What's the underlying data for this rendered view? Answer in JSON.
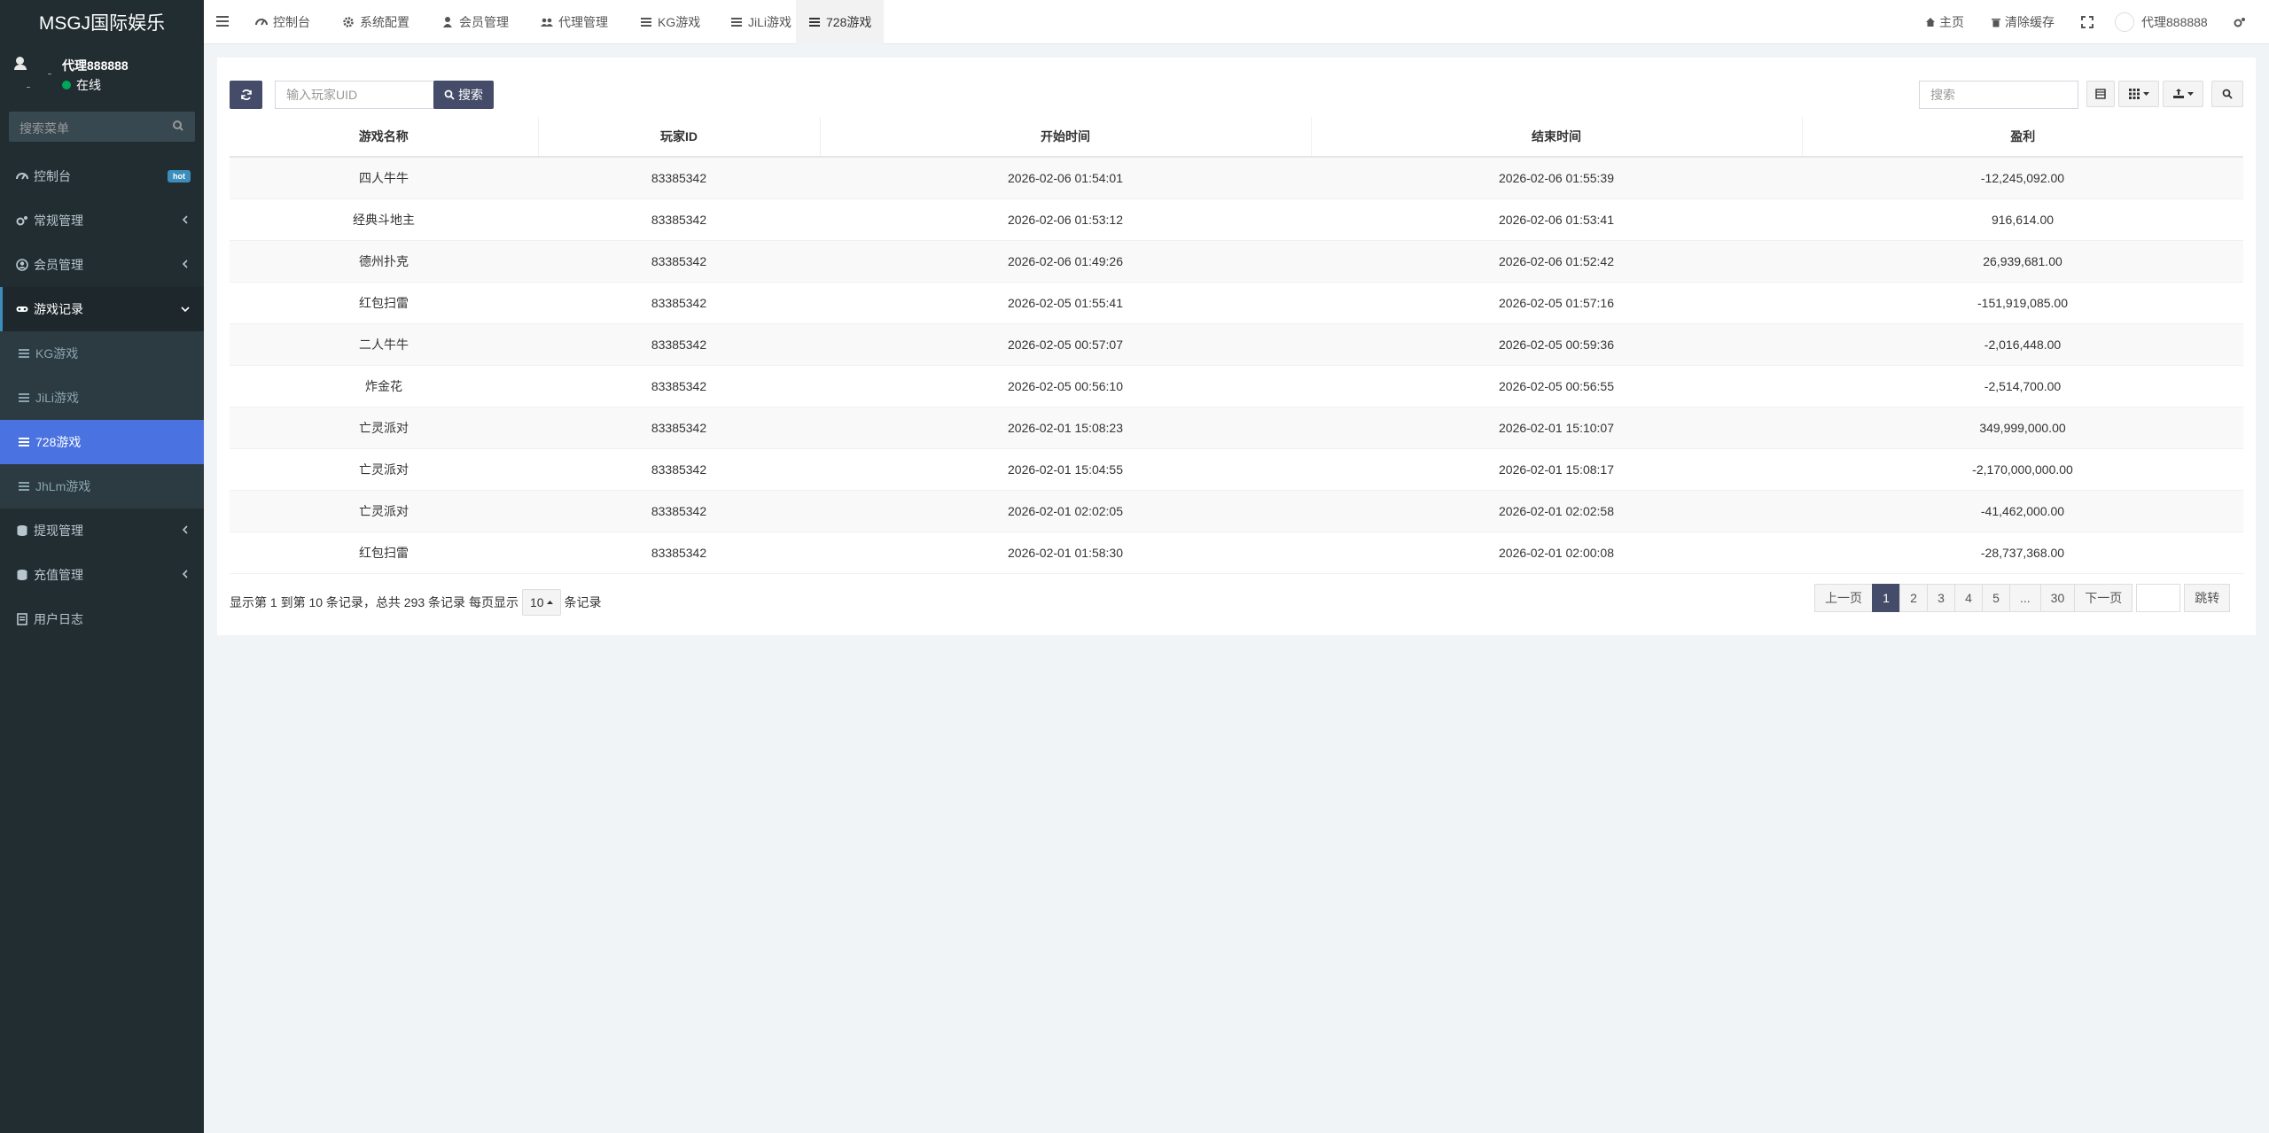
{
  "app": {
    "logo": "MSGJ国际娱乐"
  },
  "user": {
    "name": "代理888888",
    "status": "在线"
  },
  "sidebar": {
    "search_placeholder": "搜索菜单",
    "items": [
      {
        "label": "控制台",
        "badge": "hot",
        "icon": "dashboard-icon"
      },
      {
        "label": "常规管理",
        "icon": "cogs-icon"
      },
      {
        "label": "会员管理",
        "icon": "user-circle-icon"
      },
      {
        "label": "游戏记录",
        "icon": "gamepad-icon"
      },
      {
        "label": "提现管理",
        "icon": "database-icon"
      },
      {
        "label": "充值管理",
        "icon": "database-icon"
      },
      {
        "label": "用户日志",
        "icon": "list-icon"
      }
    ],
    "sub_items": [
      {
        "label": "KG游戏"
      },
      {
        "label": "JiLi游戏"
      },
      {
        "label": "728游戏"
      },
      {
        "label": "JhLm游戏"
      }
    ]
  },
  "tabs": [
    {
      "label": "控制台"
    },
    {
      "label": "系统配置"
    },
    {
      "label": "会员管理"
    },
    {
      "label": "代理管理"
    },
    {
      "label": "KG游戏"
    },
    {
      "label": "JiLi游戏"
    },
    {
      "label": "728游戏"
    }
  ],
  "topnav": {
    "home": "主页",
    "clear_cache": "清除缓存",
    "user": "代理888888"
  },
  "toolbar": {
    "uid_placeholder": "输入玩家UID",
    "search_btn": "搜索",
    "right_search_placeholder": "搜索"
  },
  "table": {
    "headers": [
      "游戏名称",
      "玩家ID",
      "开始时间",
      "结束时间",
      "盈利"
    ],
    "rows": [
      [
        "四人牛牛",
        "83385342",
        "2026-02-06 01:54:01",
        "2026-02-06 01:55:39",
        "-12,245,092.00"
      ],
      [
        "经典斗地主",
        "83385342",
        "2026-02-06 01:53:12",
        "2026-02-06 01:53:41",
        "916,614.00"
      ],
      [
        "德州扑克",
        "83385342",
        "2026-02-06 01:49:26",
        "2026-02-06 01:52:42",
        "26,939,681.00"
      ],
      [
        "红包扫雷",
        "83385342",
        "2026-02-05 01:55:41",
        "2026-02-05 01:57:16",
        "-151,919,085.00"
      ],
      [
        "二人牛牛",
        "83385342",
        "2026-02-05 00:57:07",
        "2026-02-05 00:59:36",
        "-2,016,448.00"
      ],
      [
        "炸金花",
        "83385342",
        "2026-02-05 00:56:10",
        "2026-02-05 00:56:55",
        "-2,514,700.00"
      ],
      [
        "亡灵派对",
        "83385342",
        "2026-02-01 15:08:23",
        "2026-02-01 15:10:07",
        "349,999,000.00"
      ],
      [
        "亡灵派对",
        "83385342",
        "2026-02-01 15:04:55",
        "2026-02-01 15:08:17",
        "-2,170,000,000.00"
      ],
      [
        "亡灵派对",
        "83385342",
        "2026-02-01 02:02:05",
        "2026-02-01 02:02:58",
        "-41,462,000.00"
      ],
      [
        "红包扫雷",
        "83385342",
        "2026-02-01 01:58:30",
        "2026-02-01 02:00:08",
        "-28,737,368.00"
      ]
    ]
  },
  "footer": {
    "summary": "显示第 1 到第 10 条记录，总共 293 条记录 每页显示",
    "page_size": "10",
    "suffix": "条记录"
  },
  "pagination": {
    "prev": "上一页",
    "pages": [
      "1",
      "2",
      "3",
      "4",
      "5",
      "...",
      "30"
    ],
    "next": "下一页",
    "jump": "跳转"
  },
  "colors": {
    "sidebar_bg": "#222d32",
    "active_item": "#4a72e0",
    "primary_btn": "#444c69",
    "online": "#00a65a",
    "hot_badge": "#3c8dbc"
  }
}
